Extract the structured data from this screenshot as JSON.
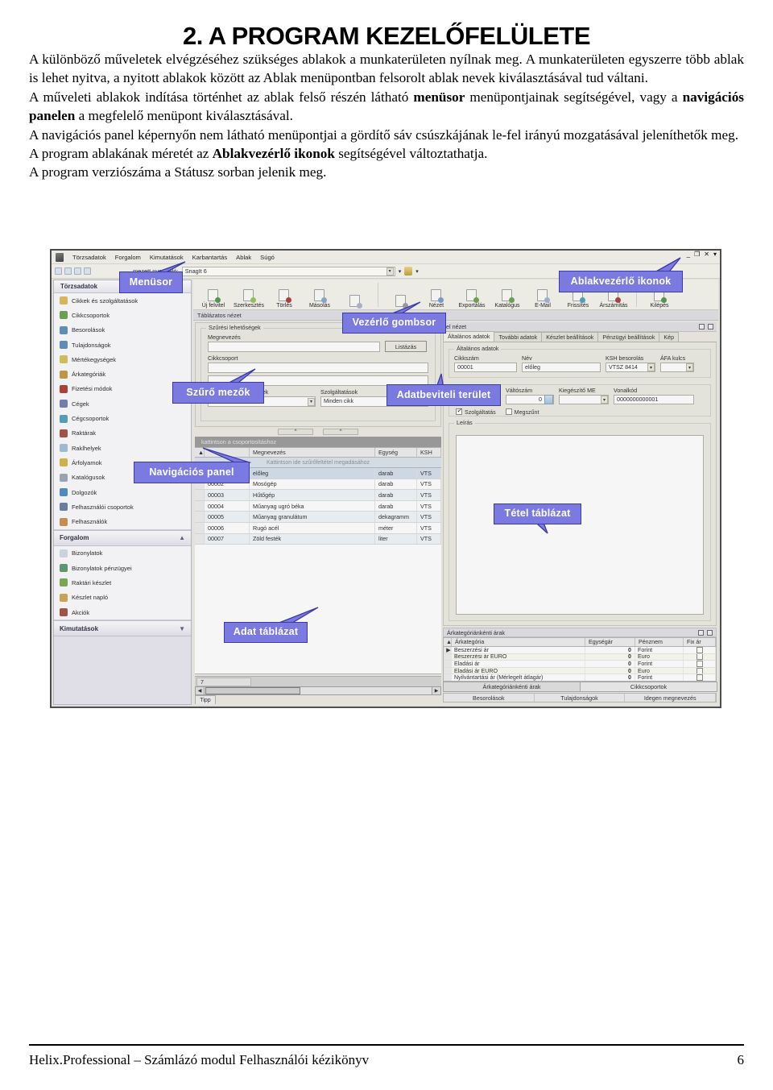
{
  "document": {
    "title": "2. A PROGRAM KEZELŐFELÜLETE",
    "paragraphs": [
      "A különböző műveletek elvégzéséhez szükséges ablakok a munkaterületen nyílnak meg. A munkaterületen egyszerre több ablak is lehet nyitva, a nyitott ablakok között az Ablak menüpontban felsorolt ablak nevek kiválasztásával tud váltani.",
      "A műveleti ablakok indítása történhet az ablak felső részén látható menüsor menüpontjainak segítségével, vagy a navigációs panelen a megfelelő menüpont kiválasztásával.",
      "A navigációs panel képernyőn nem látható menüpontjai a gördítő sáv csúszkájának le-fel irányú mozgatásával jeleníthetők meg.",
      "A program ablakának méretét az Ablakvezérlő ikonok segítségével változtathatja.",
      "A program verziószáma a Státusz sorban jelenik meg."
    ],
    "bold_terms": [
      "menüsor",
      "navigációs panelen",
      "Ablakvezérlő ikonok"
    ],
    "footer": {
      "text": "Helix.Professional – Számlázó modul Felhasználói kézikönyv",
      "page": "6"
    }
  },
  "screenshot": {
    "menubar": {
      "items": [
        "Törzsadatok",
        "Forgalom",
        "Kimutatások",
        "Karbantartás",
        "Ablak",
        "Súgó"
      ],
      "window_controls": [
        "minimize",
        "restore",
        "close",
        "dropdown"
      ]
    },
    "printbar": {
      "label": "mezett nyomtató:",
      "printer": "SnagIt 6"
    },
    "nav_panel": {
      "header": "Törzsadatok",
      "items": [
        {
          "label": "Cikkek és szolgáltatások",
          "color": "#e8b93c"
        },
        {
          "label": "Cikkcsoportok",
          "color": "#5fa83d"
        },
        {
          "label": "Besorolások",
          "color": "#4f8fc9"
        },
        {
          "label": "Tulajdonságok",
          "color": "#4f8fc9"
        },
        {
          "label": "Mértékegységek",
          "color": "#d9c33a"
        },
        {
          "label": "Árkategóriák",
          "color": "#c89a2a"
        },
        {
          "label": "Fizetési módok",
          "color": "#c0392b"
        },
        {
          "label": "Cégek",
          "color": "#6b7fbf"
        },
        {
          "label": "Cégcsoportok",
          "color": "#3fa3c2"
        },
        {
          "label": "Raktárak",
          "color": "#b94a3a"
        },
        {
          "label": "Raklhelyek",
          "color": "#9bc0de"
        },
        {
          "label": "Árfolyamok",
          "color": "#e0b429"
        },
        {
          "label": "Katalógusok",
          "color": "#9aa7b8"
        },
        {
          "label": "Dolgozók",
          "color": "#3f8fd0"
        },
        {
          "label": "Felhasználói csoportok",
          "color": "#5f7fa8"
        },
        {
          "label": "Felhasználók",
          "color": "#d98c3a"
        }
      ],
      "groups": [
        {
          "title": "Forgalom",
          "chevron": "chevron-up-icon",
          "items": [
            {
              "label": "Bizonylatok",
              "color": "#cfd8e6"
            },
            {
              "label": "Bizonylatok pénzügyei",
              "color": "#4f9c6b"
            },
            {
              "label": "Raktári készlet",
              "color": "#6fae3c"
            },
            {
              "label": "Készlet napló",
              "color": "#d9a43c"
            },
            {
              "label": "Akciók",
              "color": "#b94a3a"
            }
          ]
        },
        {
          "title": "Kimutatások",
          "chevron": "chevron-down-icon",
          "items": []
        }
      ]
    },
    "toolbar": {
      "group1": [
        {
          "label": "Új felvitel",
          "icon": "new-document-icon",
          "badge": "#3f9e3f"
        },
        {
          "label": "Szerkesztés",
          "icon": "edit-document-icon",
          "badge": "#8cc63f"
        },
        {
          "label": "Törlés",
          "icon": "delete-document-icon",
          "badge": "#cc3333"
        },
        {
          "label": "Másolás",
          "icon": "copy-document-icon",
          "badge": "#7fa8d6"
        },
        {
          "label": "",
          "icon": "paste-document-icon",
          "badge": "#9db8d8"
        }
      ],
      "group2": [
        {
          "label": "",
          "icon": "print-icon",
          "badge": "#9a9a9a"
        },
        {
          "label": "Nézet",
          "icon": "preview-icon",
          "badge": "#6f9fd8"
        },
        {
          "label": "Exportálás",
          "icon": "export-icon",
          "badge": "#5fa83d"
        },
        {
          "label": "Katalógus",
          "icon": "catalog-icon",
          "badge": "#5fa83d"
        },
        {
          "label": "E-Mail",
          "icon": "email-icon",
          "badge": "#9ab4d6"
        },
        {
          "label": "Frissítés",
          "icon": "refresh-icon",
          "badge": "#3fa3c2"
        },
        {
          "label": "Árszámítás",
          "icon": "calculator-icon",
          "badge": "#c0392b"
        }
      ],
      "group3": [
        {
          "label": "Kilépés",
          "icon": "exit-icon",
          "badge": "#3f9e3f"
        }
      ]
    },
    "view_bar": {
      "label": "Táblázatos nézet"
    },
    "detail_view_bar": {
      "label": "el nézet"
    },
    "filters": {
      "group_title": "Szűrési lehetőségek",
      "name_label": "Megnevezés",
      "name_value": "",
      "group_label": "Cikkcsoport",
      "group_value": "",
      "extra_value": "",
      "list_button": "Listázás",
      "status_label": "Megszűnt, létező cikkek",
      "status_value": "Minden cikk",
      "service_label": "Szolgáltatások",
      "service_value": "Minden cikk"
    },
    "grey_hint": "kattintson a csoportosításhoz",
    "data_grid": {
      "columns": [
        "",
        "Megnevezés",
        "Egység",
        "KSH"
      ],
      "filter_row_hint": "Kattintson ide szűrőfeltétel megadásához",
      "rows": [
        {
          "num": "00001",
          "name": "előleg",
          "unit": "darab",
          "ksh": "VTS"
        },
        {
          "num": "00002",
          "name": "Mosógép",
          "unit": "darab",
          "ksh": "VTS"
        },
        {
          "num": "00003",
          "name": "Hűtőgép",
          "unit": "darab",
          "ksh": "VTS"
        },
        {
          "num": "00004",
          "name": "Műanyag ugró béka",
          "unit": "darab",
          "ksh": "VTS"
        },
        {
          "num": "00005",
          "name": "Műanyag granulátum",
          "unit": "dekagramm",
          "ksh": "VTS"
        },
        {
          "num": "00006",
          "name": "Rugó acél",
          "unit": "méter",
          "ksh": "VTS"
        },
        {
          "num": "00007",
          "name": "Zöld festék",
          "unit": "liter",
          "ksh": "VTS"
        }
      ],
      "record_count": "7"
    },
    "status_tab": "Tipp",
    "detail_tabs": [
      {
        "label": "Általános adatok",
        "active": true
      },
      {
        "label": "További adatok",
        "active": false
      },
      {
        "label": "Készlet beállítások",
        "active": false
      },
      {
        "label": "Pénzügyi beállítások",
        "active": false
      },
      {
        "label": "Kép",
        "active": false
      }
    ],
    "detail_form": {
      "group1_title": "Általános adatok",
      "fields": [
        {
          "label": "Cikkszám",
          "value": "00001"
        },
        {
          "label": "Név",
          "value": "előleg"
        },
        {
          "label": "KSH besorolás",
          "value": "VTSZ 8414"
        },
        {
          "label": "ÁFA kulcs",
          "value": ""
        }
      ],
      "unit_value": "darab",
      "change_label": "Váltószám",
      "change_value": "0",
      "extra_unit_label": "Kiegészítő ME",
      "extra_unit_value": "",
      "barcode_label": "Vonalkód",
      "barcode_value": "0000000000001",
      "checkbox_service": {
        "label": "Szolgáltatás",
        "checked": true
      },
      "checkbox_closed": {
        "label": "Megszűnt",
        "checked": false
      },
      "desc_label": "Leírás",
      "desc_value": ""
    },
    "price_grid": {
      "title": "Árkategóriánkénti árak",
      "columns": [
        "",
        "Árkategória",
        "Egységár",
        "Pénznem",
        "Fix ár"
      ],
      "rows": [
        {
          "cat": "Beszerzési ár",
          "price": "0",
          "cur": "Forint",
          "fix": false
        },
        {
          "cat": "Beszerzési ár EURO",
          "price": "0",
          "cur": "Euro",
          "fix": false
        },
        {
          "cat": "Eladási ár",
          "price": "0",
          "cur": "Forint",
          "fix": false
        },
        {
          "cat": "Eladási ár EURO",
          "price": "0",
          "cur": "Euro",
          "fix": false
        },
        {
          "cat": "Nyilvántartási ár (Mérlegelt átlagár)",
          "price": "0",
          "cur": "Forint",
          "fix": false
        }
      ]
    },
    "bottom_tabs": [
      {
        "label": "Árkategóriánkénti árak",
        "active": true
      },
      {
        "label": "Cikkcsoportok",
        "active": false
      }
    ],
    "sub_tabs": [
      "Besorolások",
      "Tulajdonságok",
      "Idegen megnevezés"
    ],
    "callouts": [
      {
        "id": "menusor",
        "text": "Menüsor"
      },
      {
        "id": "vezerlo",
        "text": "Vezérlő gombsor"
      },
      {
        "id": "ablakvezerlo",
        "text": "Ablakvezérlő ikonok"
      },
      {
        "id": "szuro",
        "text": "Szűrő mezők"
      },
      {
        "id": "adatbeviteli",
        "text": "Adatbeviteli terület"
      },
      {
        "id": "navigacios",
        "text": "Navigációs panel"
      },
      {
        "id": "adat",
        "text": "Adat táblázat"
      },
      {
        "id": "tetel",
        "text": "Tétel táblázat"
      }
    ]
  }
}
